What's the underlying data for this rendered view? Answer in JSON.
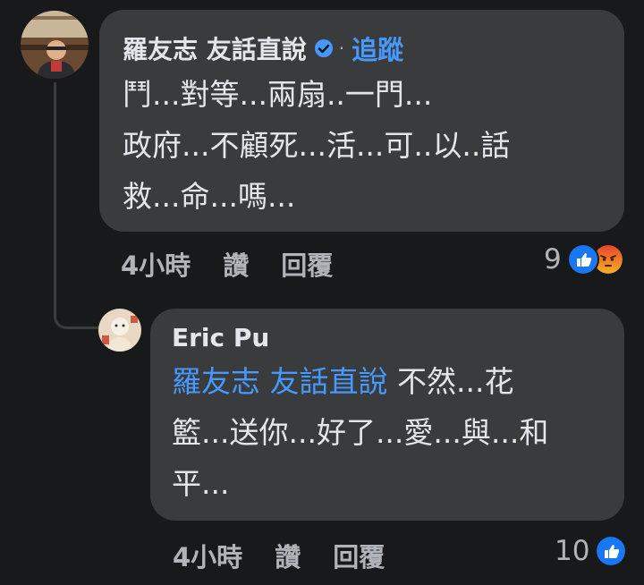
{
  "comment": {
    "author": "羅友志 友話直說",
    "separator": "·",
    "follow_label": "追蹤",
    "lines": [
      "鬥...對等...兩扇..一門...",
      "政府...不顧死...活...可..以..話",
      "救...命...嗎..."
    ],
    "time": "4小時",
    "like_label": "讚",
    "reply_label": "回覆",
    "reaction_count": "9",
    "reactions": [
      "like-icon",
      "angry-icon"
    ]
  },
  "reply": {
    "author": "Eric Pu",
    "mention": "羅友志 友話直說",
    "line1_rest": " 不然...花",
    "lines": [
      "籃...送你...好了...愛...與...和",
      "平..."
    ],
    "time": "4小時",
    "like_label": "讚",
    "reply_label": "回覆",
    "reaction_count": "10",
    "reactions": [
      "like-icon"
    ]
  },
  "colors": {
    "background": "#18191a",
    "bubble": "#3a3b3c",
    "text": "#e4e6eb",
    "secondary": "#b0b3b8",
    "accent": "#4599ff",
    "like": "#1877f2",
    "angry": "#f05b3a"
  }
}
